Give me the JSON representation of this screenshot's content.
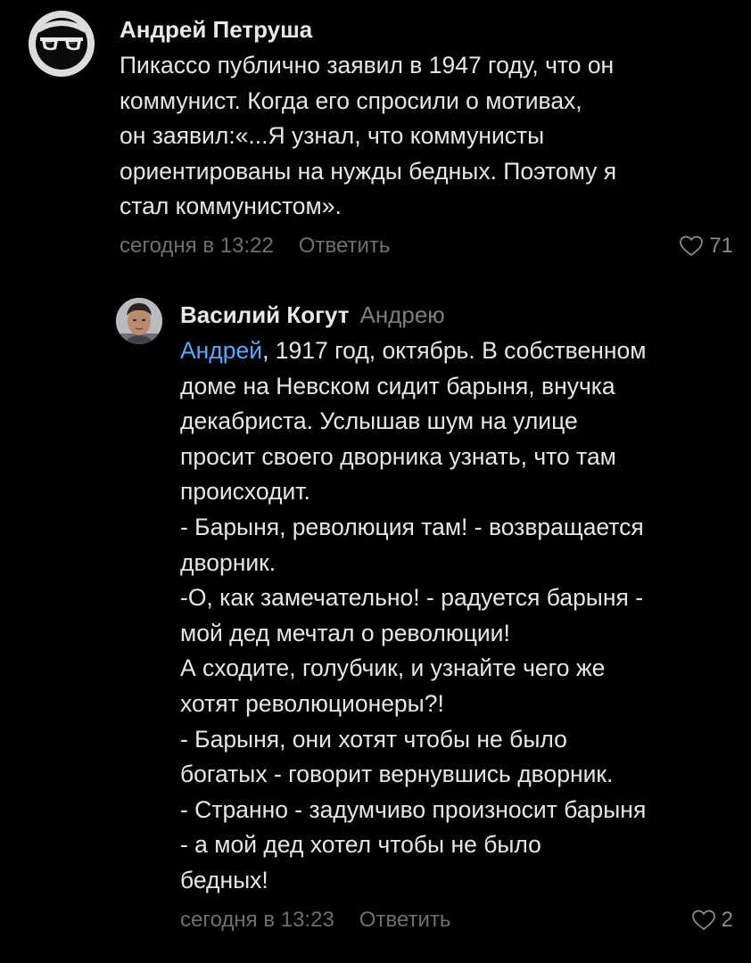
{
  "comments": [
    {
      "author": "Андрей Петруша",
      "text_lines": [
        "Пикассо публично заявил в 1947 году, что он",
        "коммунист. Когда его спросили о мотивах,",
        "он заявил:«...Я узнал, что коммунисты",
        "ориентированы на нужды бедных. Поэтому я",
        "стал коммунистом»."
      ],
      "time": "сегодня в 13:22",
      "reply_label": "Ответить",
      "likes": "71"
    },
    {
      "author": "Василий Когут",
      "reply_to": "Андрею",
      "mention": "Андрей",
      "first_line_rest": ", 1917 год, октябрь. В собственном",
      "text_lines": [
        "доме на Невском сидит барыня, внучка",
        "декабриста. Услышав шум на улице",
        "просит своего дворника узнать, что там",
        "происходит.",
        "- Барыня, революция там! - возвращается",
        "дворник.",
        "-О, как замечательно! - радуется барыня -",
        "мой дед мечтал о революции!",
        "А сходите, голубчик, и узнайте чего же",
        "хотят революционеры?!",
        "- Барыня, они хотят чтобы не было",
        "богатых - говорит вернувшись дворник.",
        "- Странно - задумчиво произносит барыня",
        "- а мой дед хотел чтобы не было",
        "бедных!"
      ],
      "time": "сегодня в 13:23",
      "reply_label": "Ответить",
      "likes": "2"
    }
  ],
  "colors": {
    "background": "#000000",
    "text": "#e6e6e6",
    "muted": "#6f6f6f",
    "mention": "#5aa7ff"
  },
  "icons": [
    "sunglasses-avatar-icon",
    "user-photo-avatar",
    "heart-icon"
  ]
}
